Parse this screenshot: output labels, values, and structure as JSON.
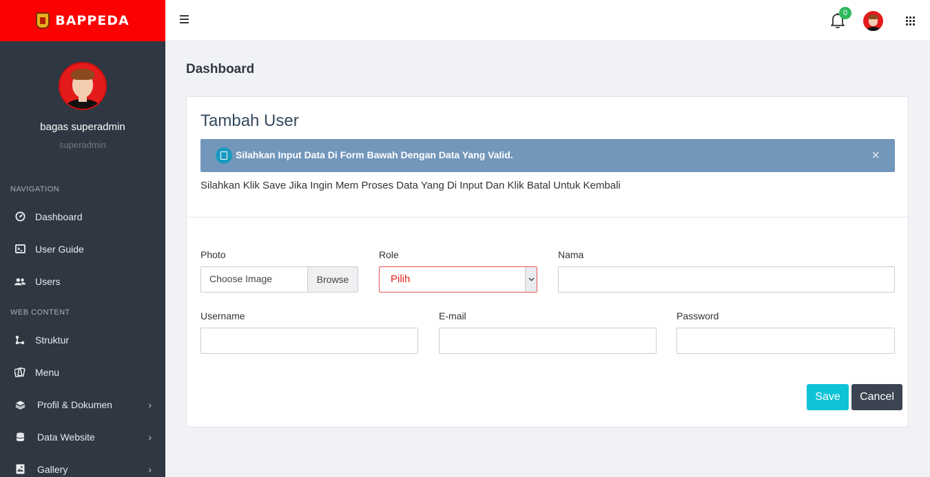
{
  "brand": {
    "name": "BAPPEDA"
  },
  "profile": {
    "name": "bagas superadmin",
    "role": "superadmin"
  },
  "sidebar": {
    "sections": [
      {
        "title": "NAVIGATION"
      },
      {
        "title": "WEB CONTENT"
      }
    ],
    "items": [
      {
        "label": "Dashboard",
        "icon": "dashboard-icon"
      },
      {
        "label": "User Guide",
        "icon": "terminal-icon"
      },
      {
        "label": "Users",
        "icon": "users-icon"
      },
      {
        "label": "Struktur",
        "icon": "sitemap-icon"
      },
      {
        "label": "Menu",
        "icon": "menu-cards-icon"
      },
      {
        "label": "Profil & Dokumen",
        "icon": "layers-icon",
        "chevron": "›"
      },
      {
        "label": "Data Website",
        "icon": "database-icon",
        "chevron": "›"
      },
      {
        "label": "Gallery",
        "icon": "image-icon",
        "chevron": "›"
      }
    ]
  },
  "header": {
    "notification_count": "0"
  },
  "page": {
    "title": "Dashboard"
  },
  "card": {
    "title": "Tambah User",
    "alert": "Silahkan Input Data Di Form Bawah Dengan Data Yang Valid.",
    "alert_close": "×",
    "description": "Silahkan Klik Save Jika Ingin Mem Proses Data Yang Di Input Dan Klik Batal Untuk Kembali"
  },
  "form": {
    "photo_label": "Photo",
    "photo_placeholder": "Choose Image",
    "browse_label": "Browse",
    "role_label": "Role",
    "role_selected": "Pilih",
    "nama_label": "Nama",
    "username_label": "Username",
    "email_label": "E-mail",
    "password_label": "Password",
    "save_label": "Save",
    "cancel_label": "Cancel"
  },
  "colors": {
    "brand_red": "#fb0101",
    "sidebar_bg": "#2f3742",
    "alert_bg": "#7397bb",
    "save_btn": "#0fc3d7",
    "cancel_btn": "#3c4452",
    "badge_green": "#2eb85c"
  }
}
